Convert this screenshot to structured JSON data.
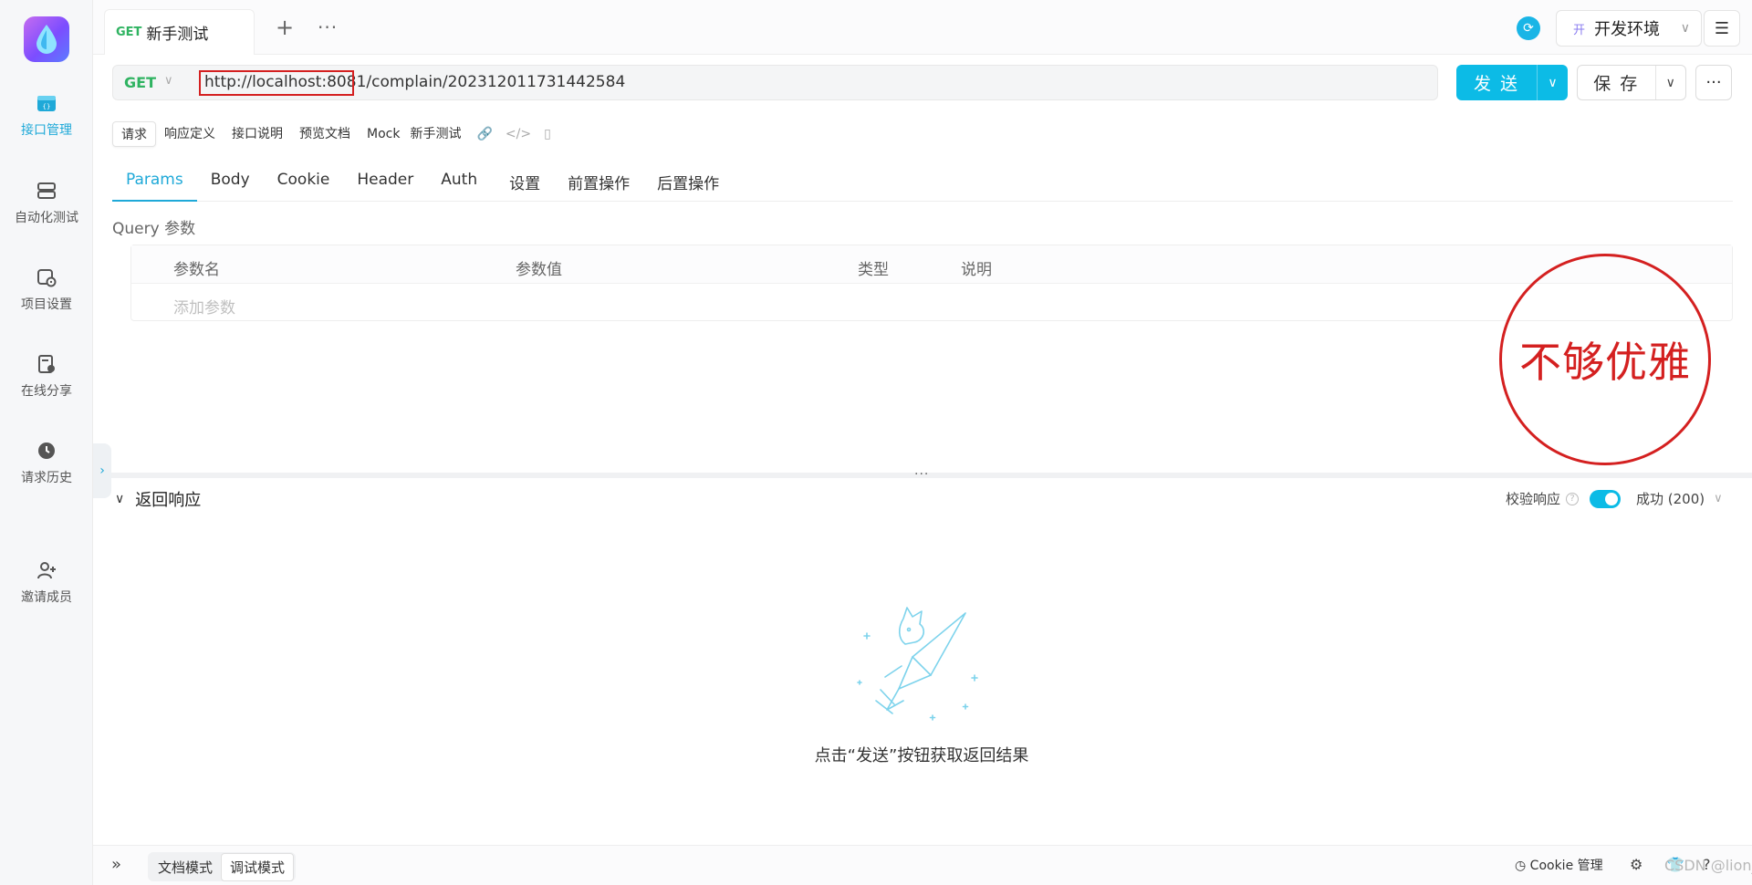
{
  "sidebar": {
    "items": [
      {
        "label": "接口管理",
        "icon": "api-icon",
        "active": true
      },
      {
        "label": "自动化测试",
        "icon": "server-stack-icon"
      },
      {
        "label": "项目设置",
        "icon": "project-settings-icon"
      },
      {
        "label": "在线分享",
        "icon": "share-doc-icon"
      },
      {
        "label": "请求历史",
        "icon": "history-clock-icon"
      },
      {
        "label": "邀请成员",
        "icon": "invite-user-icon"
      }
    ]
  },
  "tabs": [
    {
      "method": "GET",
      "title": "新手测试"
    }
  ],
  "header": {
    "add_tab": "+",
    "more_tabs": "···",
    "env_prefix": "开",
    "env_name": "开发环境"
  },
  "request": {
    "method": "GET",
    "url": "http://localhost:8081/complain/202312011731442584",
    "send_label": "发 送",
    "save_label": "保 存"
  },
  "segments": [
    "请求",
    "响应定义",
    "接口说明",
    "预览文档",
    "Mock",
    "新手测试"
  ],
  "param_tabs": [
    "Params",
    "Body",
    "Cookie",
    "Header",
    "Auth",
    "设置",
    "前置操作",
    "后置操作"
  ],
  "query": {
    "label": "Query 参数",
    "columns": [
      "参数名",
      "参数值",
      "类型",
      "说明"
    ],
    "add_placeholder": "添加参数"
  },
  "stamp_text": "不够优雅",
  "splitter_dots": "···",
  "response": {
    "title": "返回响应",
    "verify_label": "校验响应",
    "verify_enabled": true,
    "status": "成功 (200)",
    "empty_hint": "点击“发送”按钮获取返回结果"
  },
  "footer": {
    "modes": [
      "文档模式",
      "调试模式"
    ],
    "active_mode": "调试模式",
    "cookie_label": "Cookie 管理",
    "watermark": "CSDN @lion_no_back"
  },
  "colors": {
    "accent": "#0cbbe6",
    "method_get": "#2fb361",
    "stamp_red": "#d42020"
  }
}
